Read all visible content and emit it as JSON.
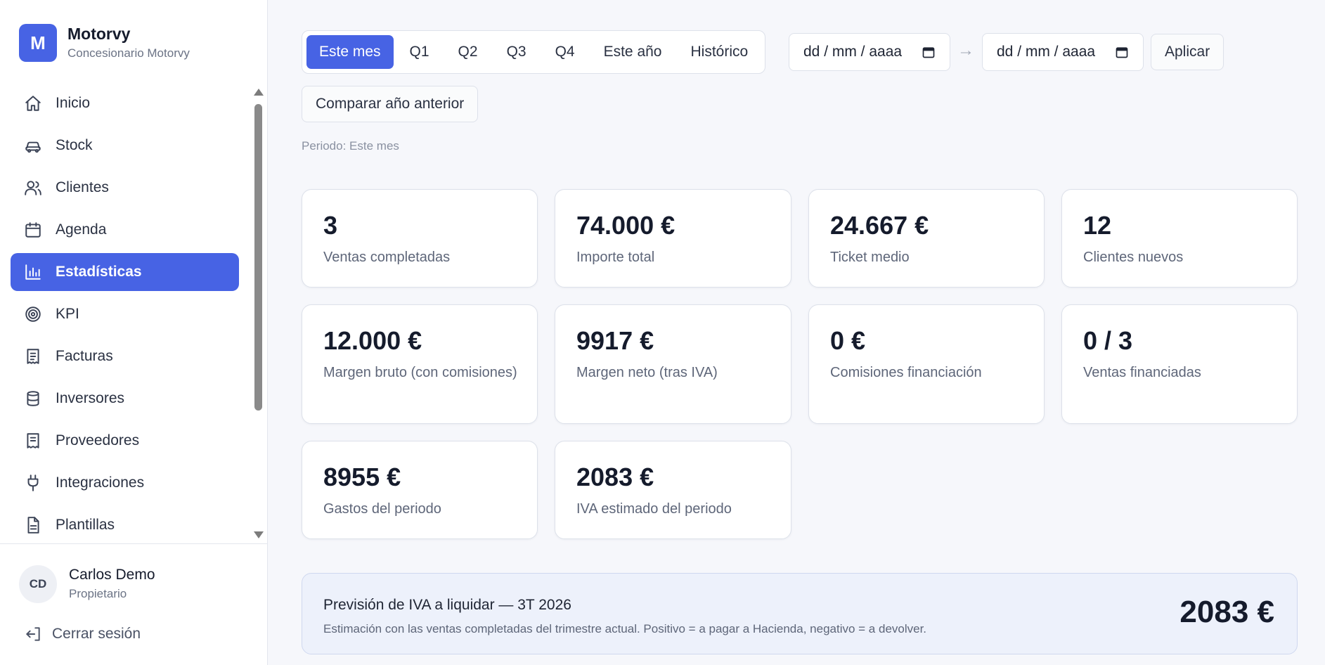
{
  "brand": {
    "logo_letter": "M",
    "name": "Motorvy",
    "subtitle": "Concesionario Motorvy"
  },
  "nav": {
    "items": [
      {
        "label": "Inicio",
        "icon": "home-icon"
      },
      {
        "label": "Stock",
        "icon": "car-icon"
      },
      {
        "label": "Clientes",
        "icon": "users-icon"
      },
      {
        "label": "Agenda",
        "icon": "calendar-icon"
      },
      {
        "label": "Estadísticas",
        "icon": "bar-chart-icon",
        "active": true
      },
      {
        "label": "KPI",
        "icon": "target-icon"
      },
      {
        "label": "Facturas",
        "icon": "invoice-icon"
      },
      {
        "label": "Inversores",
        "icon": "database-icon"
      },
      {
        "label": "Proveedores",
        "icon": "receipt-icon"
      },
      {
        "label": "Integraciones",
        "icon": "plug-icon"
      },
      {
        "label": "Plantillas",
        "icon": "file-icon"
      }
    ]
  },
  "user": {
    "initials": "CD",
    "name": "Carlos Demo",
    "role": "Propietario",
    "logout_label": "Cerrar sesión"
  },
  "filters": {
    "tabs": [
      "Este mes",
      "Q1",
      "Q2",
      "Q3",
      "Q4",
      "Este año",
      "Histórico"
    ],
    "active_tab": "Este mes",
    "date_from_placeholder": "dd / mm / aaaa",
    "date_to_placeholder": "dd / mm / aaaa",
    "arrow": "→",
    "apply_label": "Aplicar",
    "compare_label": "Comparar año anterior",
    "period_text": "Periodo: Este mes"
  },
  "kpis": [
    {
      "value": "3",
      "label": "Ventas completadas"
    },
    {
      "value": "74.000 €",
      "label": "Importe total"
    },
    {
      "value": "24.667 €",
      "label": "Ticket medio"
    },
    {
      "value": "12",
      "label": "Clientes nuevos"
    },
    {
      "value": "12.000 €",
      "label": "Margen bruto (con comisiones)"
    },
    {
      "value": "9917 €",
      "label": "Margen neto (tras IVA)"
    },
    {
      "value": "0 €",
      "label": "Comisiones financiación"
    },
    {
      "value": "0 / 3",
      "label": "Ventas financiadas"
    },
    {
      "value": "8955 €",
      "label": "Gastos del periodo"
    },
    {
      "value": "2083 €",
      "label": "IVA estimado del periodo"
    }
  ],
  "vat_forecast": {
    "title": "Previsión de IVA a liquidar — 3T 2026",
    "description": "Estimación con las ventas completadas del trimestre actual. Positivo = a pagar a Hacienda, negativo = a devolver.",
    "amount": "2083 €"
  },
  "colors": {
    "accent": "#4763e4",
    "background": "#f6f7fb",
    "card": "#ffffff",
    "vat_box": "#edf1fb"
  }
}
